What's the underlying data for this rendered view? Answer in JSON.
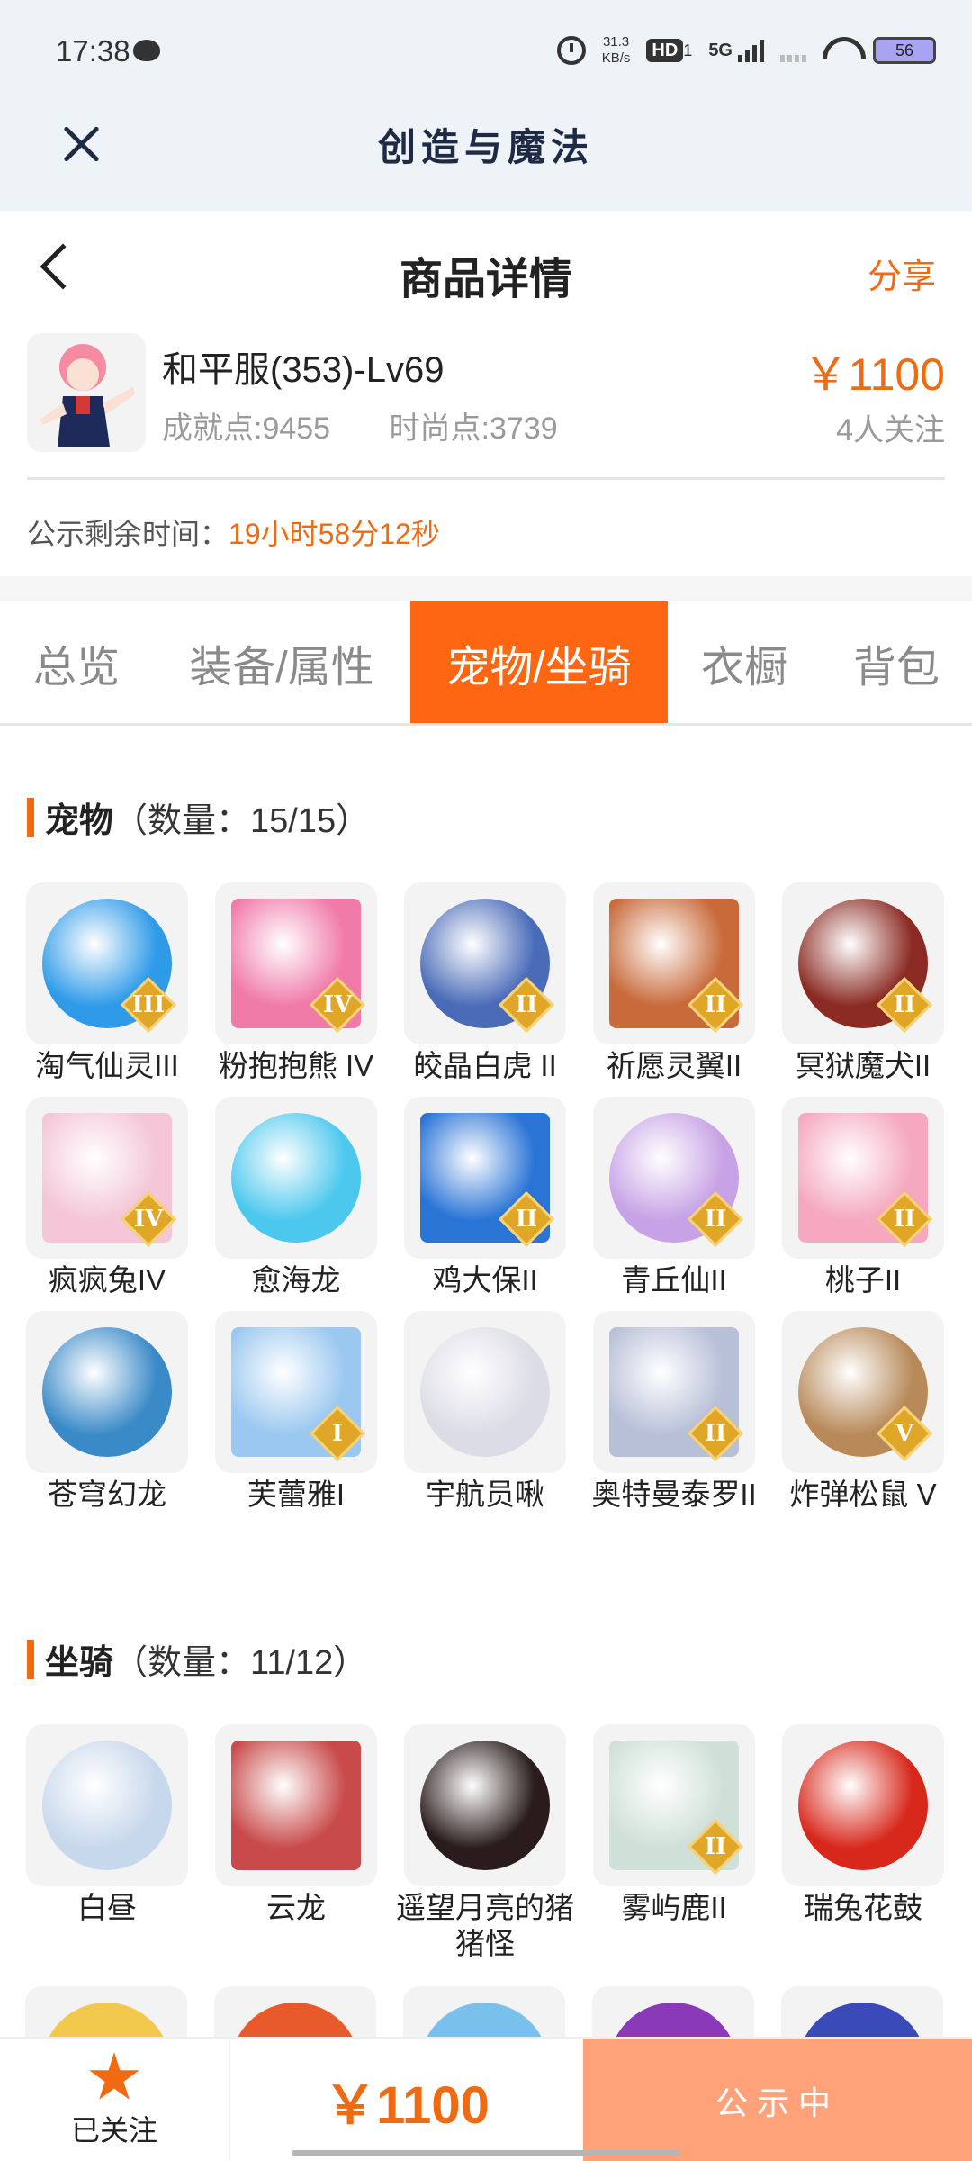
{
  "status_bar": {
    "time": "17:38",
    "net_speed_value": "31.3",
    "net_speed_unit": "KB/s",
    "hd": "HD",
    "hd_sub": "1",
    "network": "5G",
    "battery": "56"
  },
  "app_bar": {
    "title": "创造与魔法"
  },
  "header": {
    "title": "商品详情",
    "share_label": "分享"
  },
  "product": {
    "name": "和平服(353)-Lv69",
    "achievement": "成就点:9455",
    "fashion": "时尚点:3739",
    "price": "￥1100",
    "followers": "4人关注",
    "countdown_label": "公示剩余时间：",
    "countdown_value": "19小时58分12秒"
  },
  "tabs": [
    {
      "label": "总览",
      "active": false
    },
    {
      "label": "装备/属性",
      "active": false
    },
    {
      "label": "宠物/坐骑",
      "active": true
    },
    {
      "label": "衣橱",
      "active": false
    },
    {
      "label": "背包",
      "active": false
    }
  ],
  "pets": {
    "title": "宠物",
    "count": "（数量：15/15）",
    "items": [
      {
        "name": "淘气仙灵III",
        "badge": "III",
        "icon": "blue-puppy",
        "color": "#2f9be8"
      },
      {
        "name": "粉抱抱熊 IV",
        "badge": "IV",
        "icon": "pink-bear",
        "color": "#f07aa8"
      },
      {
        "name": "皎晶白虎 II",
        "badge": "II",
        "icon": "white-tiger",
        "color": "#4a6bb8"
      },
      {
        "name": "祈愿灵翼II",
        "badge": "II",
        "icon": "griffin",
        "color": "#c86a3a"
      },
      {
        "name": "冥狱魔犬II",
        "badge": "II",
        "icon": "hell-hound",
        "color": "#8a2a22"
      },
      {
        "name": "疯疯兔IV",
        "badge": "IV",
        "icon": "crazy-rabbit",
        "color": "#f4c6d8"
      },
      {
        "name": "愈海龙",
        "badge": "",
        "icon": "sea-dragon",
        "color": "#4cc8ee"
      },
      {
        "name": "鸡大保II",
        "badge": "II",
        "icon": "blue-chicken",
        "color": "#2a74d6"
      },
      {
        "name": "青丘仙II",
        "badge": "II",
        "icon": "fox-fairy",
        "color": "#c7a2e6"
      },
      {
        "name": "桃子II",
        "badge": "II",
        "icon": "peach-cat",
        "color": "#f5a8c0"
      },
      {
        "name": "苍穹幻龙",
        "badge": "",
        "icon": "sky-dragon",
        "color": "#3a8ac8"
      },
      {
        "name": "芙蕾雅I",
        "badge": "I",
        "icon": "freya",
        "color": "#9ac8f0"
      },
      {
        "name": "宇航员啾",
        "badge": "",
        "icon": "astronaut-bird",
        "color": "#dcdce6"
      },
      {
        "name": "奥特曼泰罗II",
        "badge": "II",
        "icon": "ultraman-taro",
        "color": "#b8c0d8"
      },
      {
        "name": "炸弹松鼠 V",
        "badge": "V",
        "icon": "bomb-squirrel",
        "color": "#b88a5a"
      }
    ]
  },
  "mounts": {
    "title": "坐骑",
    "count": "（数量：11/12）",
    "items": [
      {
        "name": "白昼",
        "badge": "",
        "icon": "white-dragon",
        "color": "#c8d8ec"
      },
      {
        "name": "云龙",
        "badge": "",
        "icon": "cloud-dragon",
        "color": "#c84a4a"
      },
      {
        "name": "遥望月亮的猪猪怪",
        "badge": "",
        "icon": "moon-pig",
        "color": "#2a1c1c"
      },
      {
        "name": "雾屿鹿II",
        "badge": "II",
        "icon": "mist-deer",
        "color": "#cfe0d8"
      },
      {
        "name": "瑞兔花鼓",
        "badge": "",
        "icon": "rabbit-drum",
        "color": "#d8281c"
      }
    ]
  },
  "bottom_bar": {
    "follow_label": "已关注",
    "price": "￥1100",
    "status_label": "公示中"
  }
}
